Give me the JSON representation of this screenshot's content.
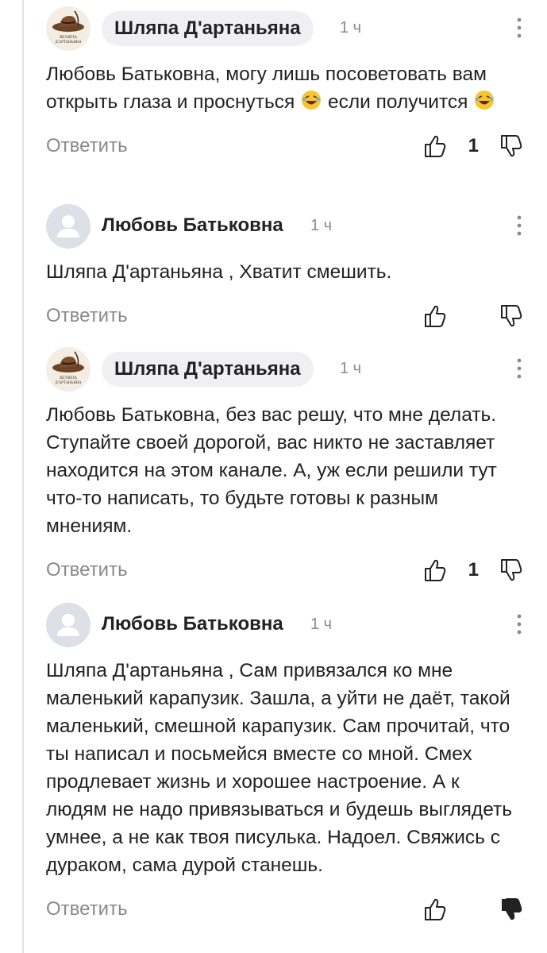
{
  "comments": [
    {
      "author": "Шляпа Д'артаньяна",
      "time": "1 ч",
      "text_parts": [
        "Любовь Батьковна, могу лишь посоветовать вам открыть глаза и проснуться",
        "если получится"
      ],
      "reply_label": "Ответить",
      "likes": "1"
    },
    {
      "author": "Любовь Батьковна",
      "time": "1 ч",
      "text": "Шляпа Д'артаньяна , Хватит смешить.",
      "reply_label": "Ответить"
    },
    {
      "author": "Шляпа Д'артаньяна",
      "time": "1 ч",
      "text": "Любовь Батьковна, без вас решу, что мне делать. Ступайте своей дорогой, вас никто не заставляет находится на этом канале. А, уж если решили тут что-то написать, то будьте готовы к разным мнениям.",
      "reply_label": "Ответить",
      "likes": "1"
    },
    {
      "author": "Любовь Батьковна",
      "time": "1 ч",
      "text": "Шляпа Д'артаньяна , Сам привязался ко мне маленький карапузик. Зашла, а уйти не даёт, такой маленький, смешной карапузик. Сам прочитай, что ты написал и посьмейся вместе со мной. Смех продлевает жизнь и хорошее настроение. А к людям не надо привязываться и будешь выглядеть умнее, а не как твоя писулька. Надоел. Свяжись с дураком, сама дурой станешь.",
      "reply_label": "Ответить"
    }
  ],
  "avatars": {
    "hat_logo_text": [
      "ШЛЯПА",
      "Д'АРТАНЬЯНА"
    ]
  },
  "colors": {
    "text": "#222222",
    "muted": "#8a8a8a",
    "chip_bg": "#f0f0f2",
    "thread_line": "#e3e3e3"
  }
}
